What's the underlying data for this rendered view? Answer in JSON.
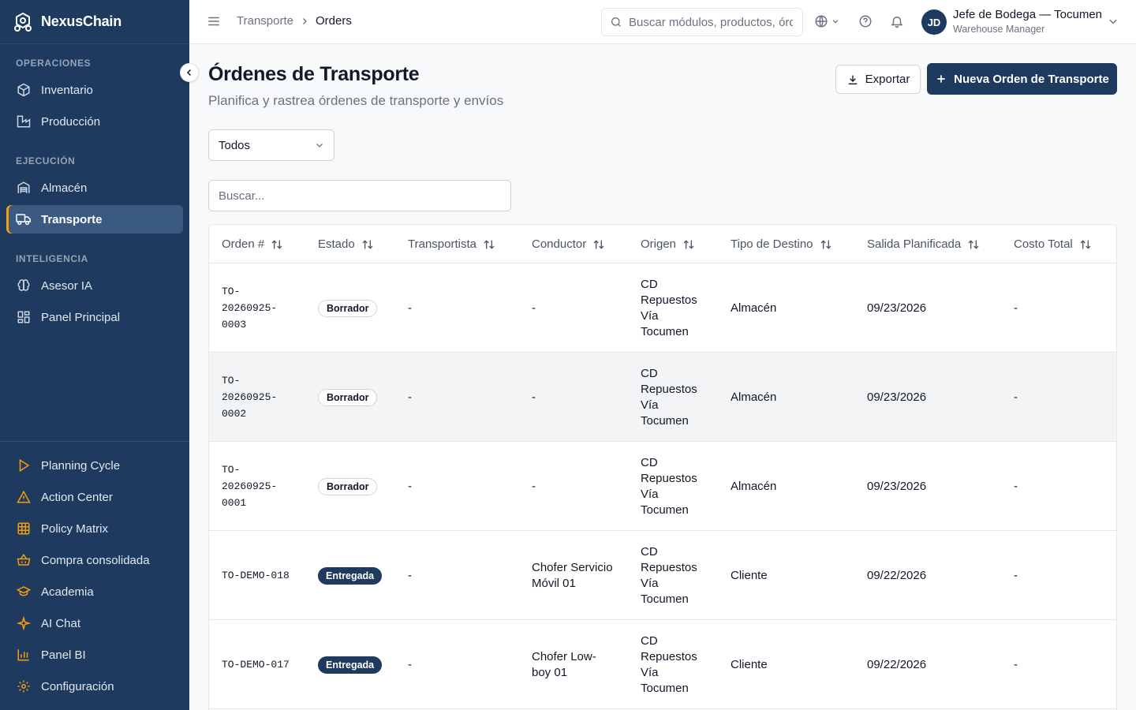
{
  "brand": {
    "name": "NexusChain"
  },
  "sidebar": {
    "sections": [
      {
        "label": "OPERACIONES",
        "items": [
          {
            "label": "Inventario",
            "icon": "box-icon"
          },
          {
            "label": "Producción",
            "icon": "factory-icon"
          }
        ]
      },
      {
        "label": "EJECUCIÓN",
        "items": [
          {
            "label": "Almacén",
            "icon": "warehouse-icon"
          },
          {
            "label": "Transporte",
            "icon": "truck-icon",
            "active": true
          }
        ]
      },
      {
        "label": "INTELIGENCIA",
        "items": [
          {
            "label": "Asesor IA",
            "icon": "brain-icon"
          },
          {
            "label": "Panel Principal",
            "icon": "dashboard-icon"
          }
        ]
      }
    ],
    "bottom_items": [
      {
        "label": "Planning Cycle",
        "icon": "play-icon"
      },
      {
        "label": "Action Center",
        "icon": "warning-icon"
      },
      {
        "label": "Policy Matrix",
        "icon": "grid-icon"
      },
      {
        "label": "Compra consolidada",
        "icon": "basket-icon"
      },
      {
        "label": "Academia",
        "icon": "graduation-cap-icon"
      },
      {
        "label": "AI Chat",
        "icon": "sparkles-icon"
      },
      {
        "label": "Panel BI",
        "icon": "bar-chart-icon"
      },
      {
        "label": "Configuración",
        "icon": "gear-icon"
      }
    ]
  },
  "topbar": {
    "breadcrumb": {
      "parent": "Transporte",
      "current": "Orders"
    },
    "search_placeholder": "Buscar módulos, productos, órdenes...",
    "user": {
      "initials": "JD",
      "name": "Jefe de Bodega — Tocumen",
      "role": "Warehouse Manager"
    }
  },
  "page": {
    "title": "Órdenes de Transporte",
    "subtitle": "Planifica y rastrea órdenes de transporte y envíos",
    "export_label": "Exportar",
    "new_label": "Nueva Orden de Transporte",
    "status_filter": "Todos",
    "search_placeholder": "Buscar..."
  },
  "table": {
    "columns": [
      "Orden #",
      "Estado",
      "Transportista",
      "Conductor",
      "Origen",
      "Tipo de Destino",
      "Salida Planificada",
      "Costo Total"
    ],
    "rows": [
      {
        "order": [
          "TO-",
          "20260925-",
          "0003"
        ],
        "status": "Borrador",
        "status_kind": "draft",
        "carrier": "-",
        "driver": [
          "-"
        ],
        "origin": [
          "CD",
          "Repuestos",
          "Vía",
          "Tocumen"
        ],
        "dest_type": "Almacén",
        "departure": "09/23/2026",
        "cost": "-"
      },
      {
        "order": [
          "TO-",
          "20260925-",
          "0002"
        ],
        "status": "Borrador",
        "status_kind": "draft",
        "carrier": "-",
        "driver": [
          "-"
        ],
        "origin": [
          "CD",
          "Repuestos",
          "Vía",
          "Tocumen"
        ],
        "dest_type": "Almacén",
        "departure": "09/23/2026",
        "cost": "-"
      },
      {
        "order": [
          "TO-",
          "20260925-",
          "0001"
        ],
        "status": "Borrador",
        "status_kind": "draft",
        "carrier": "-",
        "driver": [
          "-"
        ],
        "origin": [
          "CD",
          "Repuestos",
          "Vía",
          "Tocumen"
        ],
        "dest_type": "Almacén",
        "departure": "09/23/2026",
        "cost": "-"
      },
      {
        "order": [
          "TO-DEMO-018"
        ],
        "status": "Entregada",
        "status_kind": "done",
        "carrier": "-",
        "driver": [
          "Chofer Servicio",
          "Móvil 01"
        ],
        "origin": [
          "CD",
          "Repuestos",
          "Vía",
          "Tocumen"
        ],
        "dest_type": "Cliente",
        "departure": "09/22/2026",
        "cost": "-"
      },
      {
        "order": [
          "TO-DEMO-017"
        ],
        "status": "Entregada",
        "status_kind": "done",
        "carrier": "-",
        "driver": [
          "Chofer Low-",
          "boy 01"
        ],
        "origin": [
          "CD",
          "Repuestos",
          "Vía",
          "Tocumen"
        ],
        "dest_type": "Cliente",
        "departure": "09/22/2026",
        "cost": "-"
      }
    ]
  }
}
